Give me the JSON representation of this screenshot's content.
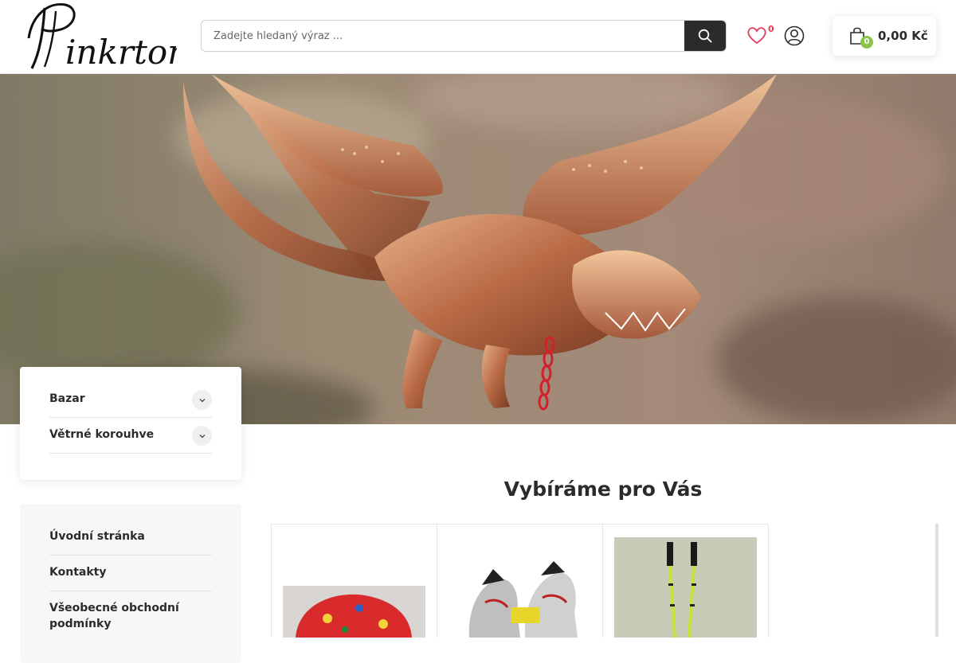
{
  "header": {
    "logo_text": "Pinkrton",
    "search": {
      "placeholder": "Zadejte hledaný výraz ..."
    },
    "wishlist_count": "0",
    "cart": {
      "count": "0",
      "total": "0,00 Kč"
    }
  },
  "colors": {
    "accent_green": "#8bc34a",
    "accent_red": "#e63b5a",
    "dark": "#2b2b2b"
  },
  "categories": [
    {
      "label": "Bazar"
    },
    {
      "label": "Větrné korouhve"
    }
  ],
  "info_links": [
    {
      "label": "Úvodní stránka"
    },
    {
      "label": "Kontakty"
    },
    {
      "label": "Všeobecné obchodní podmínky"
    }
  ],
  "main": {
    "section_title": "Vybíráme pro Vás"
  },
  "products": [
    {
      "icon": "helmet-image"
    },
    {
      "icon": "ski-boots-image"
    },
    {
      "icon": "ski-poles-image"
    }
  ]
}
